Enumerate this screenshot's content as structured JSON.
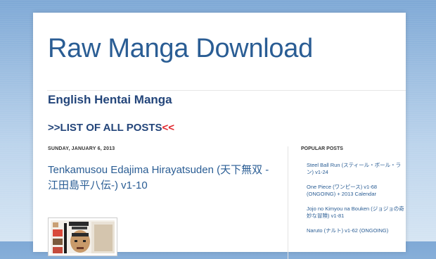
{
  "header": {
    "blog_title": "Raw Manga Download"
  },
  "nav": {
    "hentai_link": "English Hentai Manga",
    "list_prefix": ">>",
    "list_label": "LIST OF ALL POSTS",
    "list_suffix": "<<"
  },
  "post": {
    "date": "SUNDAY, JANUARY 6, 2013",
    "title": "Tenkamusou Edajima Hirayatsuden (天下無双 -江田島平八伝-) v1-10"
  },
  "sidebar": {
    "title": "POPULAR POSTS",
    "items": [
      "Steel Ball Run (スティール・ボール・ラン) v1-24",
      "One Piece (ワンピース) v1-68 (ONGOING) + 2013 Calendar",
      "Jojo no Kimyou na Bouken (ジョジョの奇妙な冒険) v1-81",
      "Naruto (ナルト) v1-62 (ONGOING)"
    ]
  },
  "colors": {
    "title_blue": "#2a5d94",
    "link_navy": "#23457a",
    "accent_red": "#e0252b"
  }
}
